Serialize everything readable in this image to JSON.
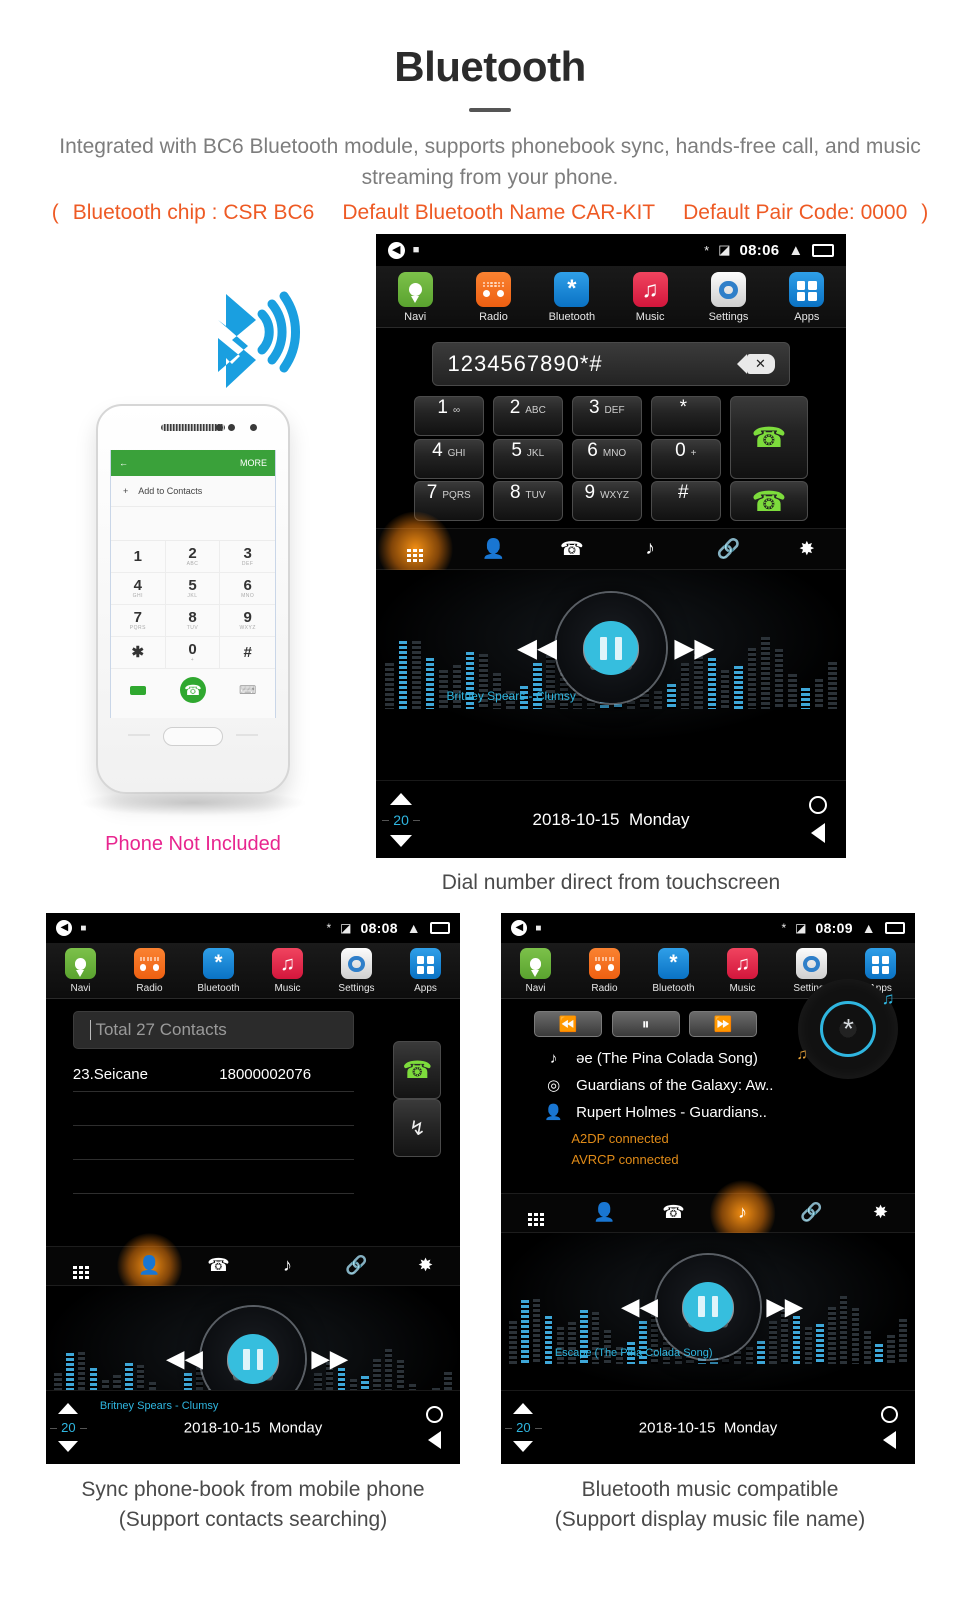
{
  "header": {
    "title": "Bluetooth",
    "description": "Integrated with BC6 Bluetooth module, supports phonebook sync, hands-free call, and music streaming from your phone.",
    "spec_open": "(",
    "spec_chip": "Bluetooth chip : CSR BC6",
    "spec_name": "Default Bluetooth Name CAR-KIT",
    "spec_pair": "Default Pair Code: 0000",
    "spec_close": ")",
    "accent_orange": "#ee5a24",
    "accent_pink": "#e8258f"
  },
  "phone_mock": {
    "bt_icon_name": "bluetooth-signal-icon",
    "back_label": "←",
    "more_label": "MORE",
    "add_contact": "Add to Contacts",
    "keys": [
      {
        "num": "1",
        "sub": ""
      },
      {
        "num": "2",
        "sub": "ABC"
      },
      {
        "num": "3",
        "sub": "DEF"
      },
      {
        "num": "4",
        "sub": "GHI"
      },
      {
        "num": "5",
        "sub": "JKL"
      },
      {
        "num": "6",
        "sub": "MNO"
      },
      {
        "num": "7",
        "sub": "PQRS"
      },
      {
        "num": "8",
        "sub": "TUV"
      },
      {
        "num": "9",
        "sub": "WXYZ"
      },
      {
        "num": "✱",
        "sub": ""
      },
      {
        "num": "0",
        "sub": "+"
      },
      {
        "num": "#",
        "sub": ""
      }
    ],
    "note": "Phone Not Included"
  },
  "appbar": {
    "items": [
      {
        "label": "Navi",
        "icon": "map-pin-icon"
      },
      {
        "label": "Radio",
        "icon": "radio-icon"
      },
      {
        "label": "Bluetooth",
        "icon": "bluetooth-icon"
      },
      {
        "label": "Music",
        "icon": "music-note-icon"
      },
      {
        "label": "Settings",
        "icon": "gear-icon"
      },
      {
        "label": "Apps",
        "icon": "grid-apps-icon"
      }
    ]
  },
  "fnbar": {
    "items": [
      {
        "icon": "dialpad-icon",
        "name": "tab-dialpad"
      },
      {
        "icon": "contact-person-icon",
        "name": "tab-contacts"
      },
      {
        "icon": "call-history-icon",
        "name": "tab-call-log"
      },
      {
        "icon": "music-note-icon",
        "name": "tab-bt-music"
      },
      {
        "icon": "link-chain-icon",
        "name": "tab-pairing"
      },
      {
        "icon": "gear-icon",
        "name": "tab-settings"
      }
    ]
  },
  "navbar": {
    "volume": "20",
    "date": "2018-10-15",
    "day": "Monday",
    "up_icon": "volume-up-triangle-icon",
    "down_icon": "volume-down-triangle-icon",
    "home_icon": "home-circle-icon",
    "back_icon": "back-triangle-icon"
  },
  "screens": {
    "dial": {
      "status": {
        "time": "08:06",
        "bt_icon": "bluetooth-icon",
        "sim_icon": "no-sim-icon",
        "up_icon": "chevron-up-icon",
        "recents_icon": "recents-icon",
        "speaker_icon": "speaker-icon",
        "screenshot_icon": "screenshot-icon"
      },
      "input_value": "1234567890*#",
      "backspace_icon": "backspace-icon",
      "keys": [
        {
          "num": "1",
          "sub": "∞"
        },
        {
          "num": "2",
          "sub": "ABC"
        },
        {
          "num": "3",
          "sub": "DEF"
        },
        {
          "num": "*",
          "sub": ""
        },
        {
          "num": "4",
          "sub": "GHI"
        },
        {
          "num": "5",
          "sub": "JKL"
        },
        {
          "num": "6",
          "sub": "MNO"
        },
        {
          "num": "0",
          "sub": "+"
        },
        {
          "num": "7",
          "sub": "PQRS"
        },
        {
          "num": "8",
          "sub": "TUV"
        },
        {
          "num": "9",
          "sub": "WXYZ"
        },
        {
          "num": "#",
          "sub": ""
        }
      ],
      "call_icon": "call-answer-icon",
      "hangup_icon": "call-end-icon",
      "active_tab": 0,
      "track": "Britney Spears - Clumsy",
      "caption": "Dial number direct from touchscreen"
    },
    "contacts": {
      "status": {
        "time": "08:08"
      },
      "search_placeholder": "Total 27 Contacts",
      "rows": [
        {
          "name": "23.Seicane",
          "number": "18000002076"
        },
        {
          "name": "",
          "number": ""
        },
        {
          "name": "",
          "number": ""
        },
        {
          "name": "",
          "number": ""
        }
      ],
      "call_icon": "call-answer-icon",
      "download_icon": "download-contacts-icon",
      "active_tab": 1,
      "track": "Britney Spears - Clumsy",
      "caption_line1": "Sync phone-book from mobile phone",
      "caption_line2": "(Support contacts searching)"
    },
    "btmusic": {
      "status": {
        "time": "08:09"
      },
      "controls": [
        {
          "icon": "previous-track-icon",
          "name": "bt-prev-button"
        },
        {
          "icon": "pause-icon",
          "name": "bt-pause-button"
        },
        {
          "icon": "next-track-icon",
          "name": "bt-next-button"
        }
      ],
      "meta": [
        {
          "icon": "music-note-icon",
          "text": "əe (The Pina Colada Song)"
        },
        {
          "icon": "album-disc-icon",
          "text": "Guardians of the Galaxy: Aw.."
        },
        {
          "icon": "artist-person-icon",
          "text": "Rupert Holmes - Guardians.."
        }
      ],
      "status_lines": [
        "A2DP  connected",
        "AVRCP connected"
      ],
      "vinyl_icon": "bluetooth-vinyl-icon",
      "active_tab": 3,
      "track": "Escape (The Pina Colada Song)",
      "caption_line1": "Bluetooth music compatible",
      "caption_line2": "(Support display music file name)"
    }
  }
}
